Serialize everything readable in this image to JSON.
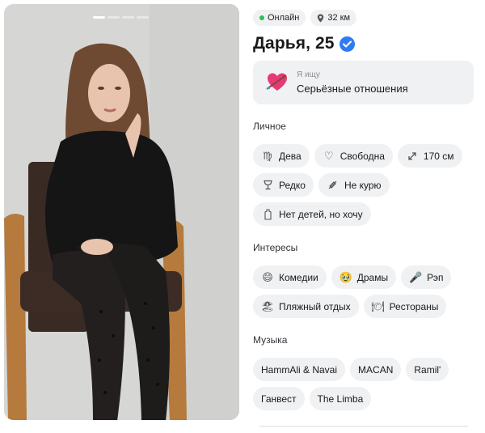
{
  "photo": {
    "pager": {
      "count": 4,
      "active": 0
    }
  },
  "status": {
    "online": "Онлайн",
    "distance": "32 км"
  },
  "profile": {
    "name_age": "Дарья, 25",
    "verified": true
  },
  "looking_for": {
    "label": "Я ищу",
    "value": "Серьёзные отношения",
    "icon": "heart-arrow-icon"
  },
  "personal": {
    "title": "Личное",
    "chips": [
      {
        "label": "Дева",
        "icon": "virgo-icon"
      },
      {
        "label": "Свободна",
        "icon": "heart-outline-icon"
      },
      {
        "label": "170 см",
        "icon": "height-icon"
      },
      {
        "label": "Редко",
        "icon": "glass-icon"
      },
      {
        "label": "Не курю",
        "icon": "no-smoking-icon"
      },
      {
        "label": "Нет детей, но хочу",
        "icon": "baby-bottle-icon"
      }
    ]
  },
  "interests": {
    "title": "Интересы",
    "chips": [
      {
        "label": "Комедии",
        "icon": "grinning-face-icon"
      },
      {
        "label": "Драмы",
        "icon": "teary-face-icon"
      },
      {
        "label": "Рэп",
        "icon": "microphone-icon"
      },
      {
        "label": "Пляжный отдых",
        "icon": "beach-icon"
      },
      {
        "label": "Рестораны",
        "icon": "cutlery-icon"
      }
    ]
  },
  "music": {
    "title": "Музыка",
    "chips": [
      {
        "label": "HammAli & Navai"
      },
      {
        "label": "MACAN"
      },
      {
        "label": "Ramil'"
      },
      {
        "label": "Ганвест"
      },
      {
        "label": "The Limba"
      }
    ]
  },
  "colors": {
    "online": "#2dbf5a",
    "verified": "#2f7bf6",
    "chip_bg": "#f0f1f3"
  }
}
